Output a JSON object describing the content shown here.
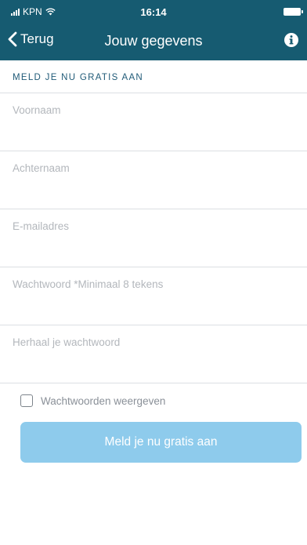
{
  "status_bar": {
    "carrier": "KPN",
    "time": "16:14"
  },
  "nav": {
    "back_label": "Terug",
    "title": "Jouw gegevens",
    "info_icon": "info-icon"
  },
  "form": {
    "section_header": "MELD JE NU GRATIS AAN",
    "fields": [
      {
        "placeholder": "Voornaam",
        "value": ""
      },
      {
        "placeholder": "Achternaam",
        "value": ""
      },
      {
        "placeholder": "E-mailadres",
        "value": ""
      },
      {
        "placeholder": "Wachtwoord *Minimaal 8 tekens",
        "value": ""
      },
      {
        "placeholder": "Herhaal je wachtwoord",
        "value": ""
      }
    ],
    "show_passwords_label": "Wachtwoorden weergeven",
    "show_passwords_checked": false,
    "submit_label": "Meld je nu gratis aan"
  },
  "colors": {
    "header_bg": "#165b71",
    "section_text": "#1f5a77",
    "button_bg": "#8ecbec"
  }
}
